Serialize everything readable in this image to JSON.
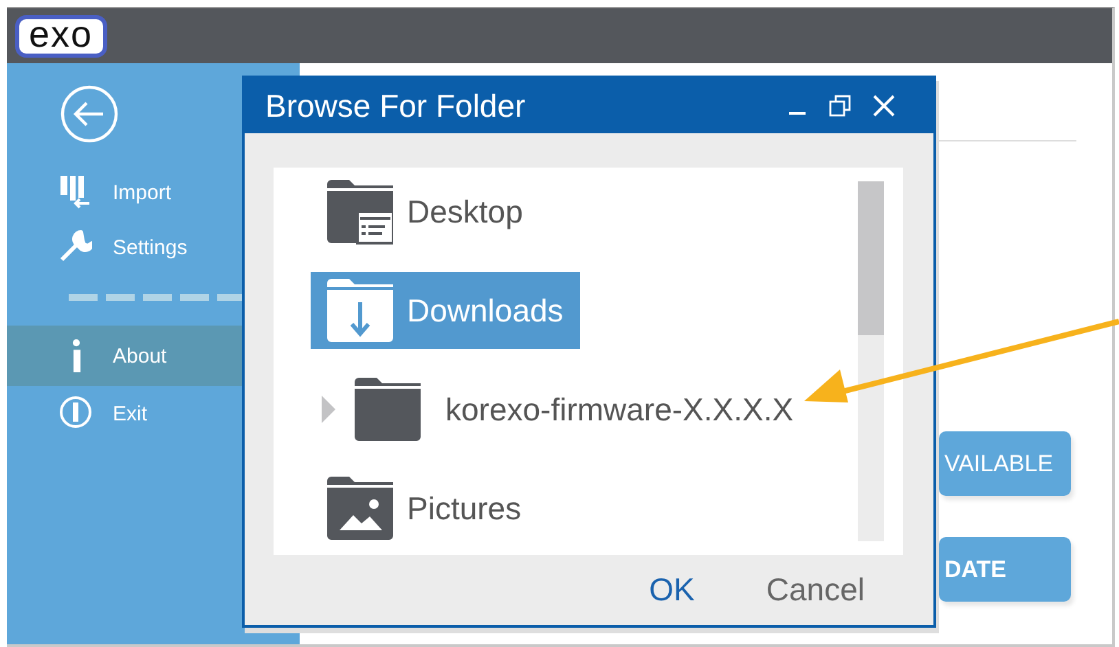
{
  "app": {
    "logo": "exo"
  },
  "sidebar": {
    "items": [
      {
        "kind": "import",
        "label": "Import",
        "selected": false
      },
      {
        "kind": "settings",
        "label": "Settings",
        "selected": false
      },
      {
        "kind": "separator"
      },
      {
        "kind": "about",
        "label": "About",
        "selected": true
      },
      {
        "kind": "exit",
        "label": "Exit",
        "selected": false
      }
    ]
  },
  "main": {
    "buttons": [
      "VAILABLE",
      "DATE"
    ]
  },
  "dialog": {
    "title": "Browse For Folder",
    "tree": [
      {
        "kind": "desktop",
        "label": "Desktop",
        "selected": false,
        "expandable": false
      },
      {
        "kind": "downloads",
        "label": "Downloads",
        "selected": true,
        "expandable": false,
        "children": [
          {
            "kind": "folder",
            "label": "korexo-firmware-X.X.X.X",
            "selected": false,
            "expandable": true
          }
        ]
      },
      {
        "kind": "pictures",
        "label": "Pictures",
        "selected": false,
        "expandable": false
      }
    ],
    "buttons": [
      {
        "label": "OK",
        "kind": "primary"
      },
      {
        "label": "Cancel",
        "kind": "secondary"
      }
    ]
  }
}
